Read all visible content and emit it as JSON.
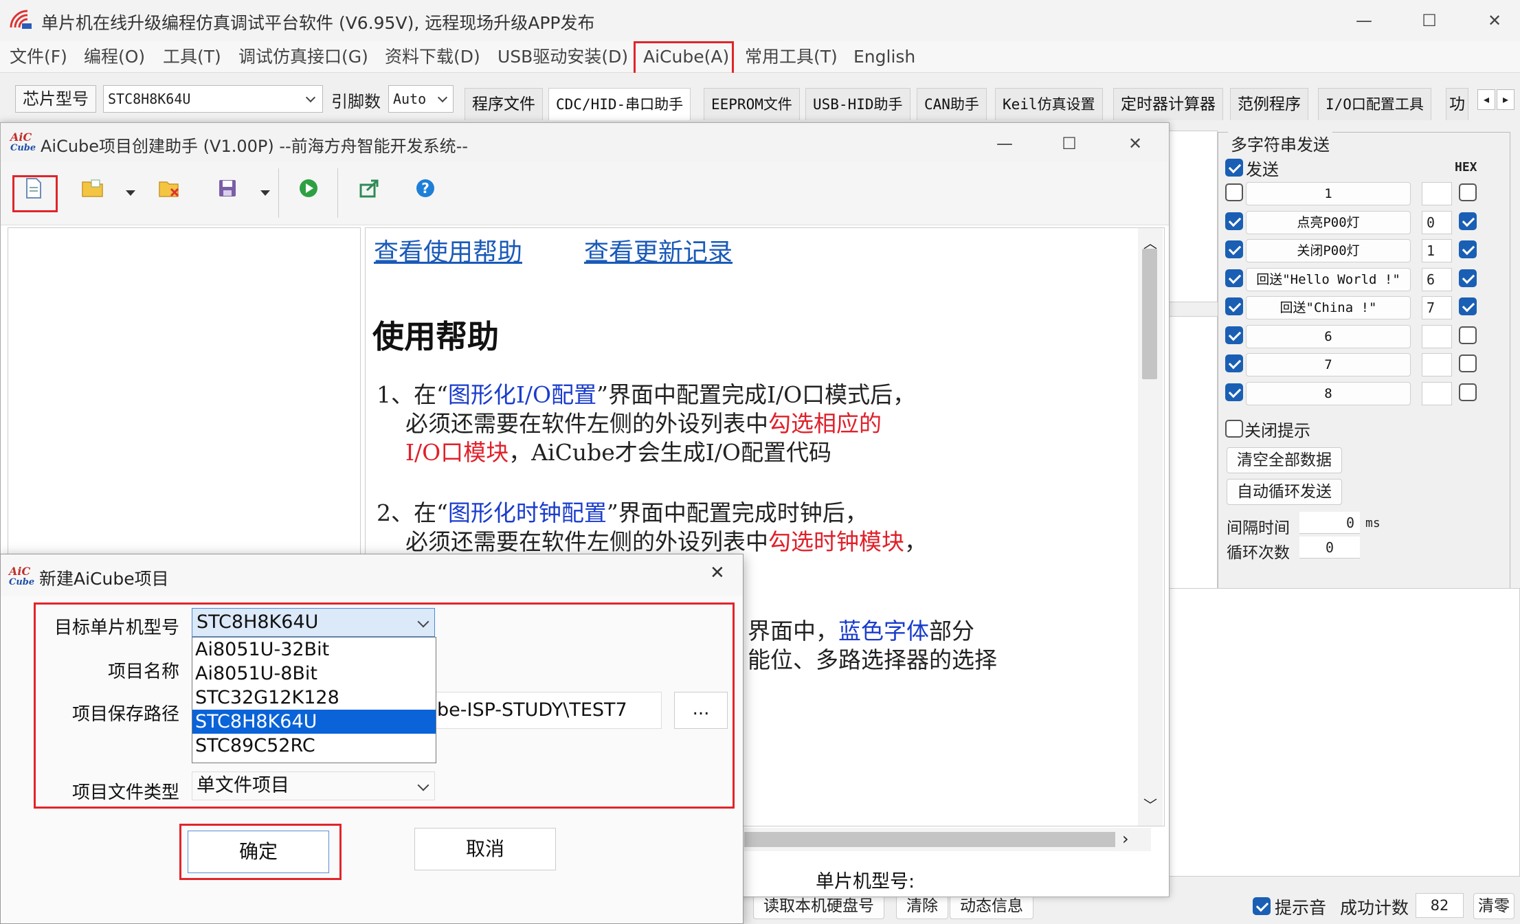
{
  "main": {
    "title": "单片机在线升级编程仿真调试平台软件 (V6.95V), 远程现场升级APP发布",
    "menu": [
      "文件(F)",
      "编程(O)",
      "工具(T)",
      "调试仿真接口(G)",
      "资料下载(D)",
      "USB驱动安装(D)",
      "AiCube(A)",
      "常用工具(T)",
      "English"
    ],
    "chip_label": "芯片型号",
    "chip_value": "STC8H8K64U",
    "pin_label": "引脚数",
    "pin_value": "Auto",
    "tabs": [
      "程序文件",
      "CDC/HID-串口助手",
      "EEPROM文件",
      "USB-HID助手",
      "CAN助手",
      "Keil仿真设置",
      "定时器计算器",
      "范例程序",
      "I/O口配置工具",
      "功"
    ]
  },
  "right_panel": {
    "group_title": "多字符串发送",
    "send_label": "发送",
    "hex_label": "HEX",
    "rows": [
      {
        "label": "1",
        "value": "",
        "checked": false,
        "hex": false
      },
      {
        "label": "点亮P00灯",
        "value": "0",
        "checked": true,
        "hex": true
      },
      {
        "label": "关闭P00灯",
        "value": "1",
        "checked": true,
        "hex": true
      },
      {
        "label": "回送\"Hello World !\"",
        "value": "6",
        "checked": true,
        "hex": true
      },
      {
        "label": "回送\"China !\"",
        "value": "7",
        "checked": true,
        "hex": true
      },
      {
        "label": "6",
        "value": "",
        "checked": true,
        "hex": false
      },
      {
        "label": "7",
        "value": "",
        "checked": true,
        "hex": false
      },
      {
        "label": "8",
        "value": "",
        "checked": true,
        "hex": false
      }
    ],
    "close_tip": "关闭提示",
    "clear_all": "清空全部数据",
    "auto_loop": "自动循环发送",
    "interval_label": "间隔时间",
    "interval_value": "0",
    "interval_unit": "ms",
    "loop_label": "循环次数",
    "loop_value": "0"
  },
  "helper": {
    "title": "AiCube项目创建助手 (V1.00P) --前海方舟智能开发系统--",
    "link_help": "查看使用帮助",
    "link_update": "查看更新记录",
    "heading": "使用帮助",
    "p1_a": "1、在“",
    "p1_b": "图形化I/O配置",
    "p1_c": "”界面中配置完成I/O口模式后，",
    "p1_d": "必须还需要在软件左侧的外设列表中",
    "p1_e": "勾选相应的",
    "p1_f": "I/O口模块",
    "p1_g": "，AiCube才会生成I/O配置代码",
    "p2_a": "2、在“",
    "p2_b": "图形化时钟配置",
    "p2_c": "”界面中配置完成时钟后，",
    "p2_d": "必须还需要在软件左侧的外设列表中",
    "p2_e": "勾选时钟模块",
    "p2_f": "，",
    "p3_a": "界面中，",
    "p3_b": "蓝色字体",
    "p3_c": "部分",
    "p3_d": "能位、多路选择器的选择"
  },
  "status": {
    "chip_model_label": "单片机型号:"
  },
  "bottom": {
    "read_disk": "读取本机硬盘号",
    "clear": "清除",
    "dynamic": "动态信息",
    "tip_sound": "提示音",
    "success_label": "成功计数",
    "success_value": "82",
    "clear_count": "清零"
  },
  "dialog": {
    "title": "新建AiCube项目",
    "target_label": "目标单片机型号",
    "target_value": "STC8H8K64U",
    "options": [
      "Ai8051U-32Bit",
      "Ai8051U-8Bit",
      "STC32G12K128",
      "STC8H8K64U",
      "STC89C52RC"
    ],
    "selected_index": 3,
    "name_label": "项目名称",
    "path_label": "项目保存路径",
    "path_value": "be-ISP-STUDY\\TEST7",
    "browse": "...",
    "type_label": "项目文件类型",
    "type_value": "单文件项目",
    "ok": "确定",
    "cancel": "取消"
  }
}
